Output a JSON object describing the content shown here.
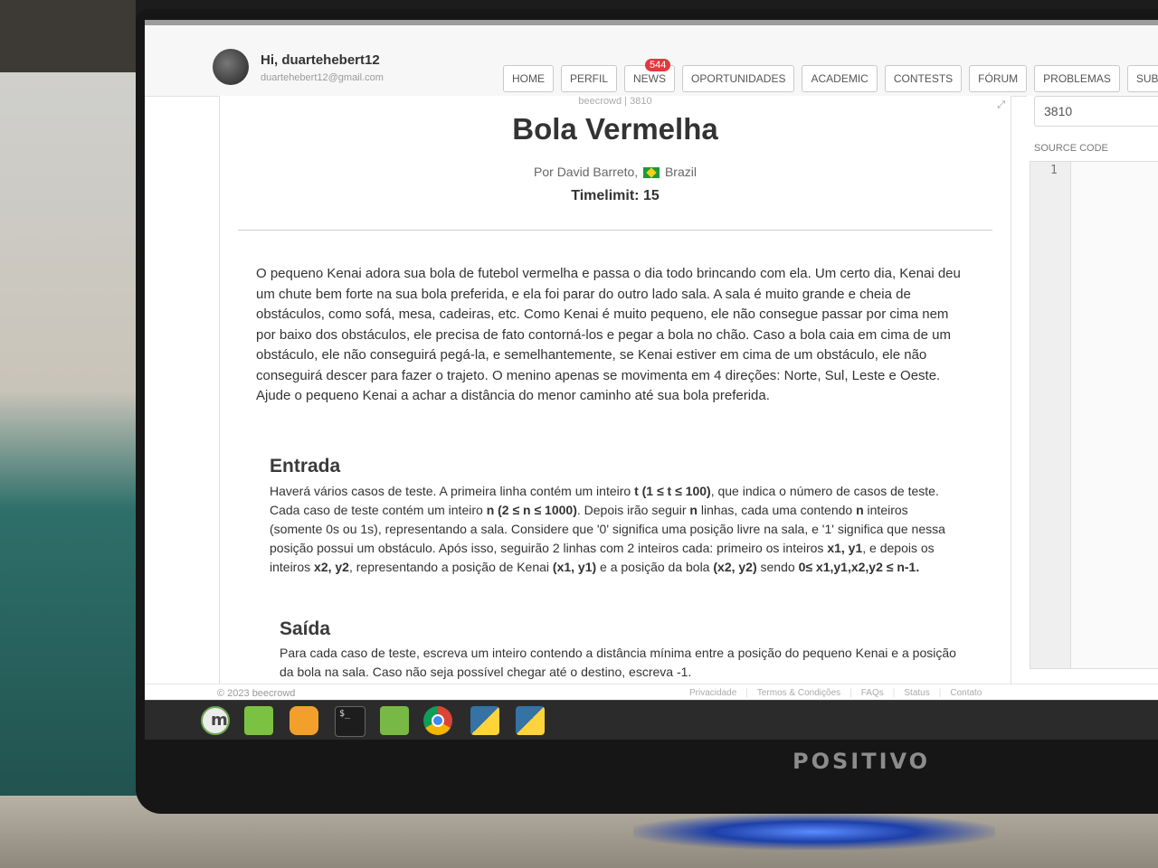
{
  "header": {
    "greeting": "Hi, duartehebert12",
    "email": "duartehebert12@gmail.com"
  },
  "nav": {
    "home": "HOME",
    "perfil": "PERFIL",
    "news": "NEWS",
    "news_badge": "544",
    "oportunidades": "OPORTUNIDADES",
    "academic": "ACADEMIC",
    "contests": "CONTESTS",
    "forum": "FÓRUM",
    "problemas": "PROBLEMAS",
    "submissoes": "SUBMISSÕ"
  },
  "problem": {
    "breadcrumb": "beecrowd | 3810",
    "title": "Bola Vermelha",
    "author_prefix": "Por David Barreto,",
    "country": "Brazil",
    "timelimit": "Timelimit: 15",
    "intro": "O pequeno Kenai adora sua bola de futebol vermelha e passa o dia todo brincando com ela. Um certo dia, Kenai deu um chute bem forte na sua bola preferida, e ela foi parar do outro lado sala. A sala é muito grande e cheia de obstáculos, como sofá, mesa, cadeiras, etc. Como Kenai é muito pequeno, ele não consegue passar por cima nem por baixo dos obstáculos, ele precisa de fato contorná-los e pegar a bola no chão. Caso a bola caia em cima de um obstáculo, ele não conseguirá pegá-la, e semelhantemente, se Kenai estiver em cima de um obstáculo, ele não conseguirá descer para fazer o trajeto. O menino apenas se movimenta em 4 direções: Norte, Sul, Leste e Oeste. Ajude o pequeno Kenai a achar a distância do menor caminho até sua bola preferida.",
    "input_heading": "Entrada",
    "input_text": {
      "p1": "Haverá vários casos de teste. A primeira linha contém um inteiro ",
      "b1": "t (1 ≤ t ≤ 100)",
      "p2": ", que indica o número de casos de teste. Cada caso de teste contém um inteiro ",
      "b2": "n (2 ≤ n ≤ 1000)",
      "p3": ". Depois irão seguir ",
      "b3": "n",
      "p4": " linhas, cada uma contendo ",
      "b4": "n",
      "p5": " inteiros (somente 0s ou 1s), representando a sala. Considere que '0' significa uma posição livre na sala, e '1' significa que nessa posição possui um obstáculo. Após isso, seguirão 2 linhas com 2 inteiros cada: primeiro os inteiros ",
      "b5": "x1, y1",
      "p6": ", e depois os inteiros ",
      "b6": "x2, y2",
      "p7": ", representando a posição de Kenai ",
      "b7": "(x1, y1)",
      "p8": " e a posição da bola ",
      "b8": "(x2, y2)",
      "p9": " sendo ",
      "b9": "0≤ x1,y1,x2,y2 ≤ n-1."
    },
    "output_heading": "Saída",
    "output_text": "Para cada caso de teste, escreva um inteiro contendo a distância mínima entre a posição do pequeno Kenai e a posição da bola na sala. Caso não seja possível chegar até o destino, escreva -1."
  },
  "sidebar": {
    "problem_id": "3810",
    "source_label": "SOURCE CODE",
    "line_number": "1"
  },
  "footer": {
    "copyright": "© 2023 beecrowd",
    "privacy": "Privacidade",
    "terms": "Termos & Condições",
    "faqs": "FAQs",
    "status": "Status",
    "contact": "Contato"
  },
  "monitor": {
    "brand": "POSITIVO"
  }
}
